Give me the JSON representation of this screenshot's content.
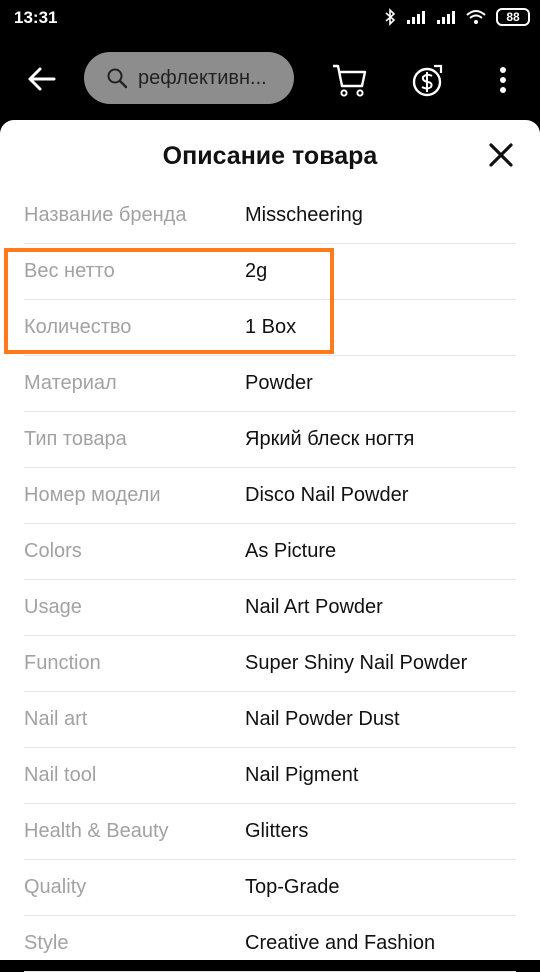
{
  "status": {
    "time": "13:31",
    "battery": "88"
  },
  "app_bar": {
    "search_text": "рефлективн..."
  },
  "sheet": {
    "title": "Описание товара",
    "rows": [
      {
        "label": "Название бренда",
        "value": "Misscheering"
      },
      {
        "label": "Вес нетто",
        "value": "2g"
      },
      {
        "label": "Количество",
        "value": "1 Box"
      },
      {
        "label": "Материал",
        "value": "Powder"
      },
      {
        "label": "Тип товара",
        "value": "Яркий блеск ногтя"
      },
      {
        "label": "Номер модели",
        "value": "Disco Nail Powder"
      },
      {
        "label": "Colors",
        "value": "As Picture"
      },
      {
        "label": "Usage",
        "value": "Nail Art Powder"
      },
      {
        "label": "Function",
        "value": "Super Shiny Nail Powder"
      },
      {
        "label": "Nail art",
        "value": "Nail Powder Dust"
      },
      {
        "label": "Nail tool",
        "value": "Nail Pigment"
      },
      {
        "label": "Health & Beauty",
        "value": "Glitters"
      },
      {
        "label": "Quality",
        "value": "Top-Grade"
      },
      {
        "label": "Style",
        "value": "Creative and Fashion"
      }
    ]
  },
  "highlight_color": "#ff7a1a"
}
